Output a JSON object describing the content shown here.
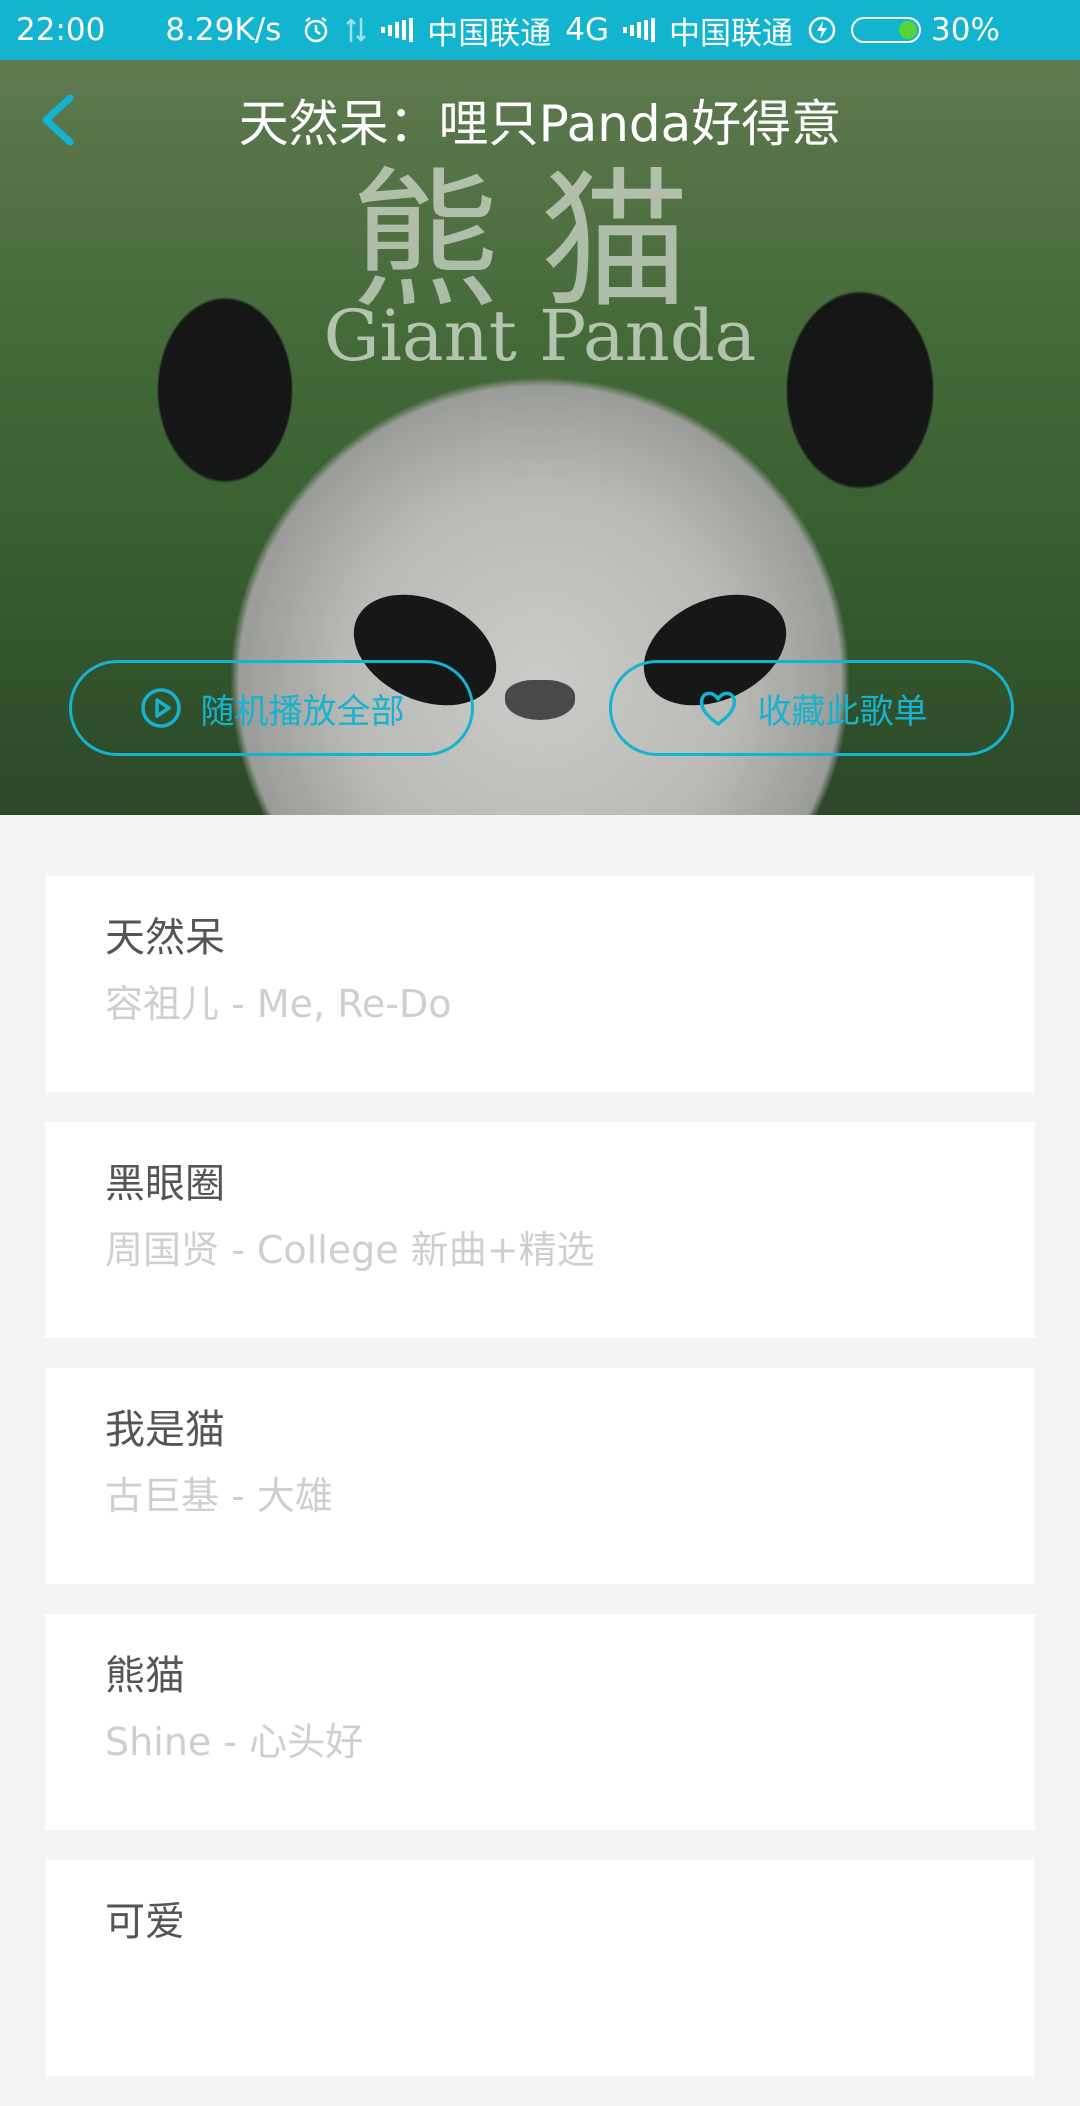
{
  "status_bar": {
    "time": "22:00",
    "speed": "8.29K/s",
    "carrier1": "中国联通",
    "network": "4G",
    "carrier2": "中国联通",
    "battery": "30%",
    "battery_level": 0.3,
    "accent": "#12b4cf"
  },
  "header": {
    "title": "天然呆：哩只Panda好得意",
    "back_icon": "chevron-left-icon"
  },
  "cover": {
    "watermark_cn": "熊猫",
    "watermark_en": "Giant Panda"
  },
  "actions": {
    "shuffle_label": "随机播放全部",
    "shuffle_icon": "play-circle-icon",
    "favorite_label": "收藏此歌单",
    "favorite_icon": "heart-icon",
    "accent": "#16b3d0"
  },
  "songs": [
    {
      "title": "天然呆",
      "subtitle": "容祖儿 - Me, Re-Do"
    },
    {
      "title": "黑眼圈",
      "subtitle": "周国贤 - College 新曲+精选"
    },
    {
      "title": "我是猫",
      "subtitle": "古巨基 - 大雄"
    },
    {
      "title": "熊猫",
      "subtitle": "Shine - 心头好"
    },
    {
      "title": "可爱",
      "subtitle": ""
    }
  ]
}
